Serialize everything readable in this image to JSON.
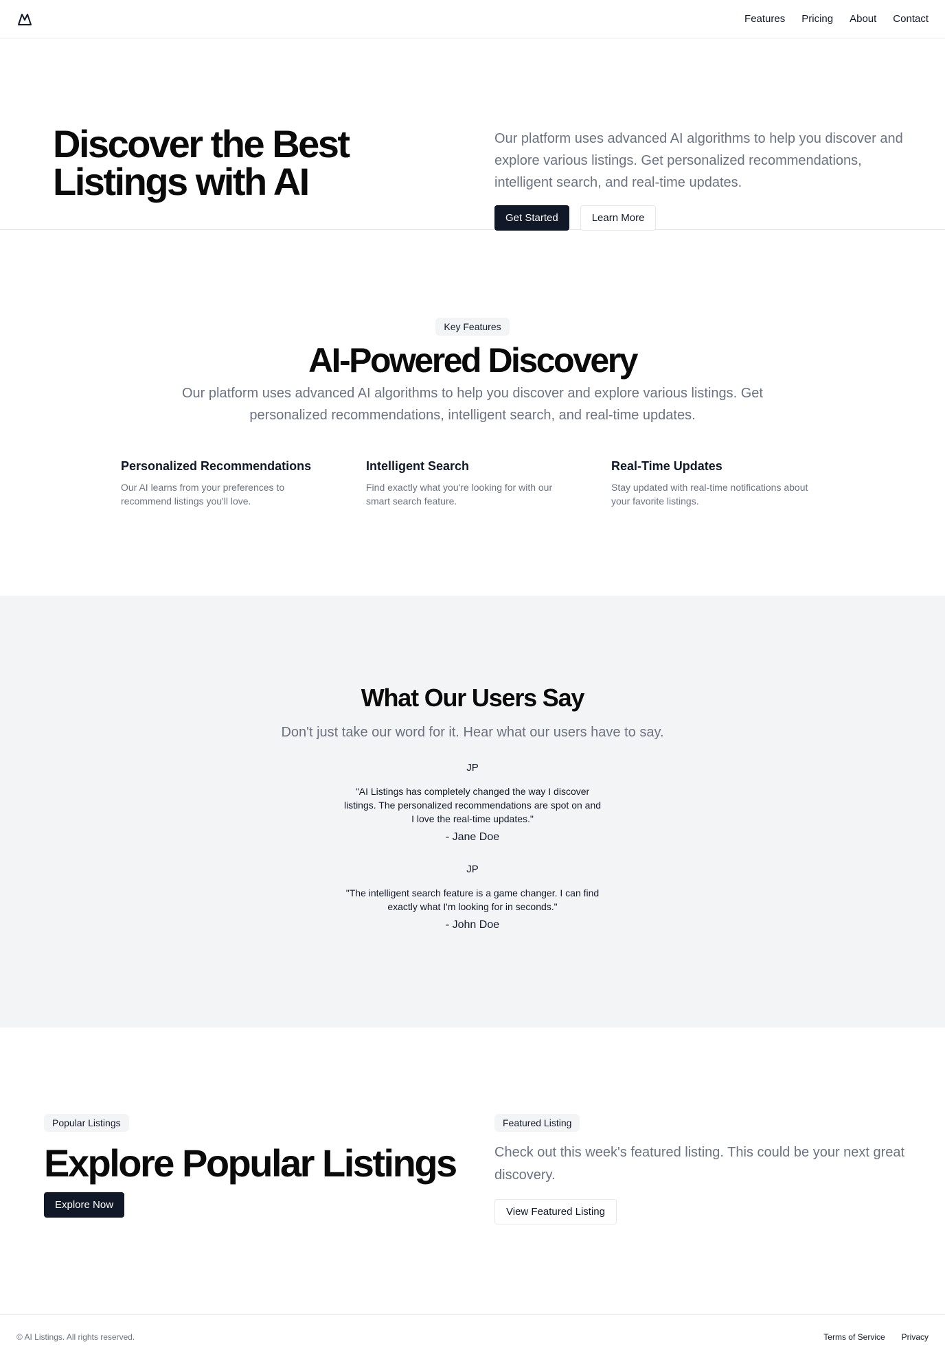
{
  "header": {
    "logo_icon": "mountain-icon",
    "nav": [
      "Features",
      "Pricing",
      "About",
      "Contact"
    ]
  },
  "hero": {
    "title": "Discover the Best Listings with AI",
    "description": "Our platform uses advanced AI algorithms to help you discover and explore various listings. Get personalized recommendations, intelligent search, and real-time updates.",
    "primary_button": "Get Started",
    "secondary_button": "Learn More"
  },
  "features": {
    "badge": "Key Features",
    "title": "AI-Powered Discovery",
    "description": "Our platform uses advanced AI algorithms to help you discover and explore various listings. Get personalized recommendations, intelligent search, and real-time updates.",
    "items": [
      {
        "title": "Personalized Recommendations",
        "text": "Our AI learns from your preferences to recommend listings you'll love."
      },
      {
        "title": "Intelligent Search",
        "text": "Find exactly what you're looking for with our smart search feature."
      },
      {
        "title": "Real-Time Updates",
        "text": "Stay updated with real-time notifications about your favorite listings."
      }
    ]
  },
  "testimonials": {
    "title": "What Our Users Say",
    "subtitle": "Don't just take our word for it. Hear what our users have to say.",
    "items": [
      {
        "avatar": "JP",
        "quote": "\"AI Listings has completely changed the way I discover listings. The personalized recommendations are spot on and I love the real-time updates.\"",
        "author": "- Jane Doe"
      },
      {
        "avatar": "JP",
        "quote": "\"The intelligent search feature is a game changer. I can find exactly what I'm looking for in seconds.\"",
        "author": "- John Doe"
      }
    ]
  },
  "popular": {
    "badge": "Popular Listings",
    "title": "Explore Popular Listings",
    "button": "Explore Now",
    "featured_badge": "Featured Listing",
    "featured_description": "Check out this week's featured listing. This could be your next great discovery.",
    "featured_button": "View Featured Listing"
  },
  "footer": {
    "copyright": "© AI Listings. All rights reserved.",
    "links": [
      "Terms of Service",
      "Privacy"
    ]
  },
  "colors": {
    "primary": "#111827",
    "muted_text": "#6b7280",
    "subtle_bg": "#f3f4f6",
    "border": "#e5e7eb"
  }
}
